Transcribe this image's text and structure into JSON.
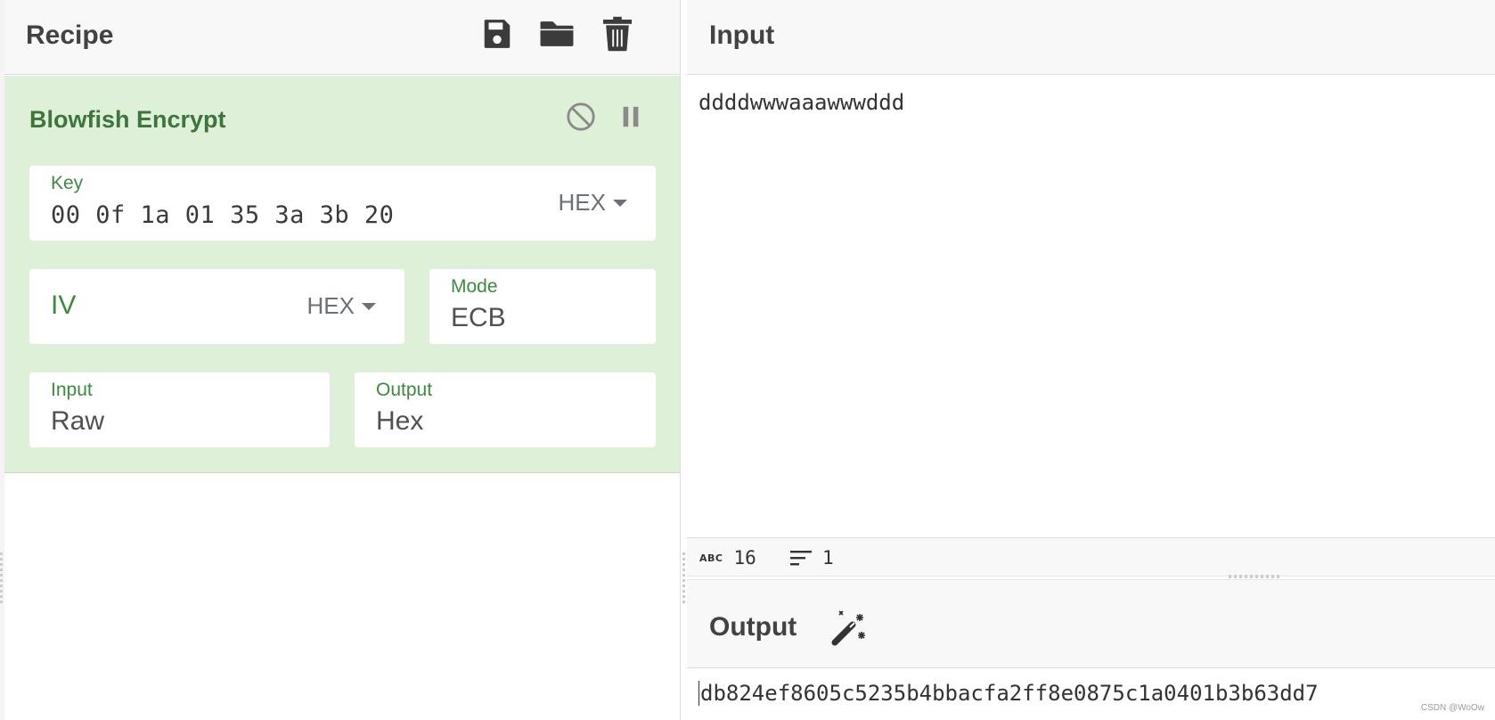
{
  "recipe": {
    "title": "Recipe",
    "icons": {
      "save": "save-icon",
      "load": "folder-icon",
      "clear": "trash-icon"
    }
  },
  "operation": {
    "name": "Blowfish Encrypt",
    "icons": {
      "disable": "disable-icon",
      "breakpoint": "pause-icon"
    },
    "key": {
      "label": "Key",
      "value": "00 0f 1a 01 35 3a 3b 20",
      "format": "HEX"
    },
    "iv": {
      "label": "IV",
      "value": "",
      "format": "HEX"
    },
    "mode": {
      "label": "Mode",
      "value": "ECB"
    },
    "input": {
      "label": "Input",
      "value": "Raw"
    },
    "output": {
      "label": "Output",
      "value": "Hex"
    }
  },
  "input_panel": {
    "title": "Input",
    "text": "ddddwwwaaawwwddd",
    "stats": {
      "length": "16",
      "lines": "1"
    }
  },
  "output_panel": {
    "title": "Output",
    "text": "db824ef8605c5235b4bbacfa2ff8e0875c1a0401b3b63dd7",
    "watermark": "CSDN @WoOw"
  },
  "colors": {
    "operation_bg": "#dff0d8",
    "operation_title": "#3c763d",
    "label": "#3c8a3e"
  }
}
